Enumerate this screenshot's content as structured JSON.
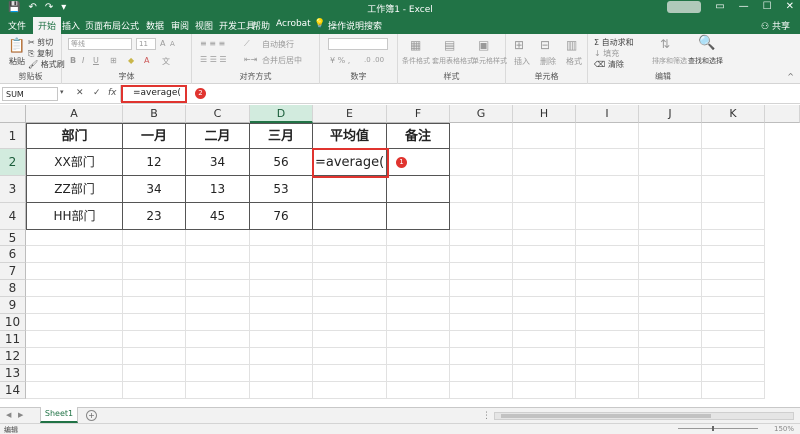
{
  "app": {
    "title": "工作簿1 - Excel",
    "share_label": "共享"
  },
  "ribbon_tabs": [
    "文件",
    "开始",
    "插入",
    "页面布局",
    "公式",
    "数据",
    "审阅",
    "视图",
    "开发工具",
    "帮助",
    "Acrobat"
  ],
  "active_tab": "开始",
  "tell_me": "操作说明搜索",
  "ribbon": {
    "clipboard": {
      "paste": "粘贴",
      "cut": "剪切",
      "copy": "复制",
      "format_painter": "格式刷",
      "label": "剪贴板"
    },
    "font": {
      "font_name": "等线",
      "font_size": "11",
      "bold": "B",
      "italic": "I",
      "underline": "U",
      "grow": "A",
      "shrink": "A",
      "label": "字体"
    },
    "alignment": {
      "wrap_text": "自动换行",
      "merge_center": "合并后居中",
      "label": "对齐方式"
    },
    "number": {
      "format": "数字",
      "label": "数字"
    },
    "styles": {
      "conditional": "条件格式",
      "table": "套用表格格式",
      "cell_styles": "单元格样式",
      "label": "样式"
    },
    "cells": {
      "insert": "插入",
      "delete": "删除",
      "format": "格式",
      "label": "单元格"
    },
    "editing": {
      "autosum": "自动求和",
      "fill": "填充",
      "clear": "清除",
      "sort": "排序和筛选",
      "find": "查找和选择",
      "label": "编辑"
    }
  },
  "formula_bar": {
    "name_box": "SUM",
    "cancel": "✕",
    "enter": "✓",
    "fx": "fx",
    "content": "=average("
  },
  "markers": {
    "one": "1",
    "two": "2"
  },
  "grid": {
    "columns": [
      "A",
      "B",
      "C",
      "D",
      "E",
      "F",
      "G",
      "H",
      "I",
      "J",
      "K"
    ],
    "rows": [
      "1",
      "2",
      "3",
      "4",
      "5",
      "6",
      "7",
      "8",
      "9",
      "10",
      "11",
      "12",
      "13",
      "14"
    ],
    "selected_column": "D",
    "selected_row": "2",
    "table": [
      [
        "部门",
        "一月",
        "二月",
        "三月",
        "平均值",
        "备注"
      ],
      [
        "XX部门",
        "12",
        "34",
        "56",
        "=average(",
        ""
      ],
      [
        "ZZ部门",
        "34",
        "13",
        "53",
        "",
        ""
      ],
      [
        "HH部门",
        "23",
        "45",
        "76",
        "",
        ""
      ]
    ]
  },
  "sheets": [
    "Sheet1"
  ],
  "add_sheet": "+",
  "status": {
    "mode": "编辑",
    "zoom": "150%"
  },
  "colors": {
    "brand": "#217346",
    "highlight": "#e0342f"
  }
}
